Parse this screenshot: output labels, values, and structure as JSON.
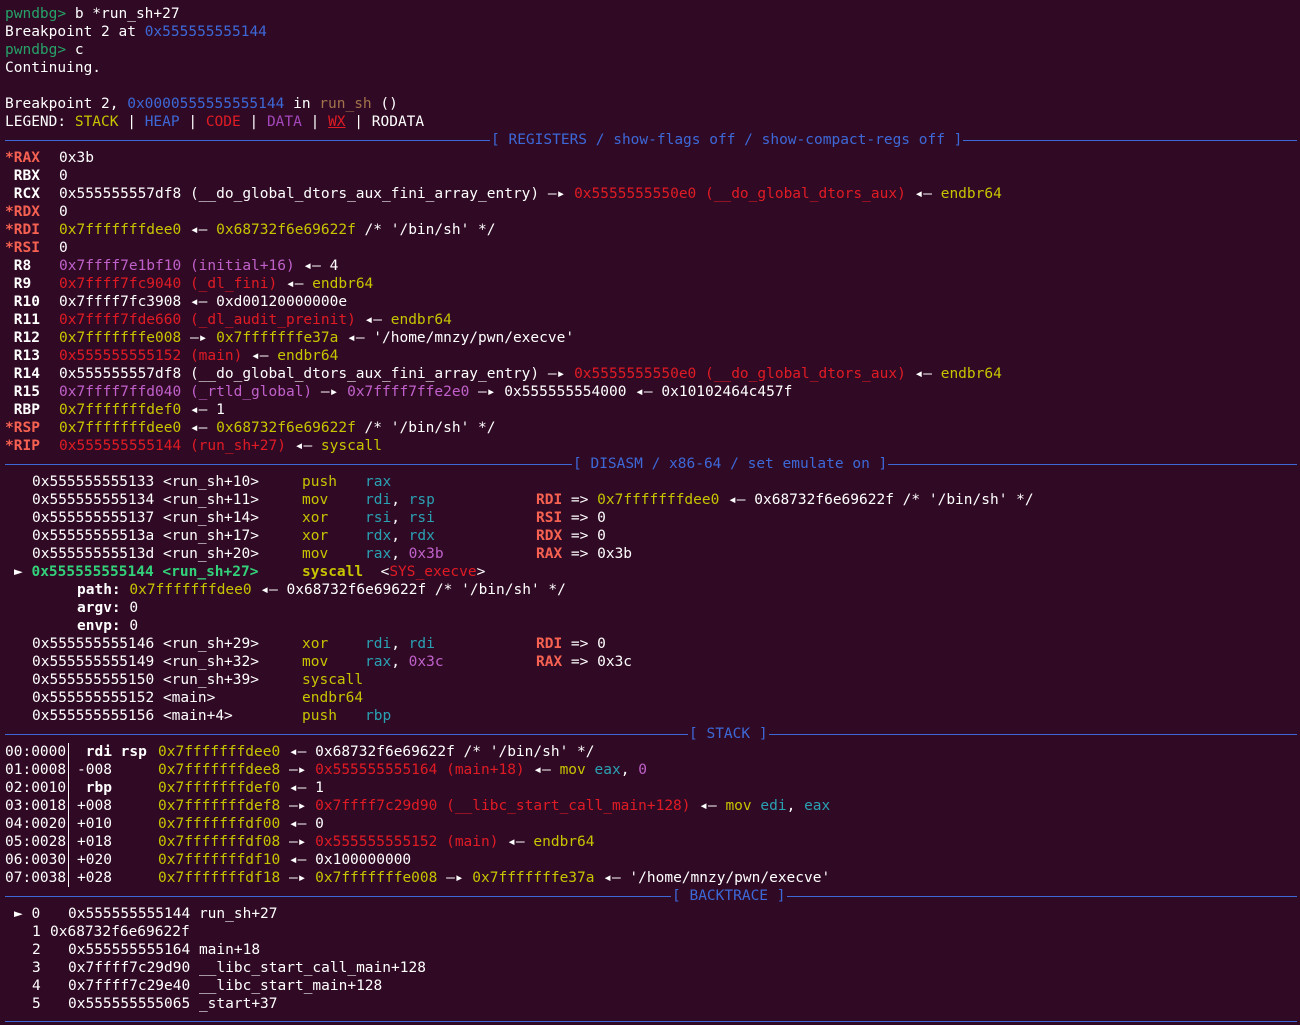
{
  "prompt": "pwndbg>",
  "cmd1": "b *run_sh+27",
  "bp_set_prefix": "Breakpoint 2 at ",
  "bp_set_addr": "0x555555555144",
  "cmd2": "c",
  "continuing": "Continuing.",
  "bp_hit": {
    "prefix": "Breakpoint 2, ",
    "addr": "0x0000555555555144",
    "in": " in ",
    "func": "run_sh",
    "suffix": " ()"
  },
  "legend": {
    "label": "LEGEND: ",
    "stack": "STACK",
    "heap": "HEAP",
    "code": "CODE",
    "data": "DATA",
    "wx": "WX",
    "rodata": "RODATA",
    "sep": " | "
  },
  "sections": {
    "registers": "[ REGISTERS / show-flags off / show-compact-regs off ]",
    "disasm": "[ DISASM / x86-64 / set emulate on ]",
    "stack": "[ STACK ]",
    "backtrace": "[ BACKTRACE ]"
  },
  "registers": [
    {
      "name": "*RAX",
      "value": "0x3b"
    },
    {
      "name": " RBX",
      "value": "0"
    },
    {
      "name": " RCX",
      "value": "0x555555557df8 (__do_global_dtors_aux_fini_array_entry) —▸ 0x5555555550e0 (__do_global_dtors_aux) ◂— endbr64"
    },
    {
      "name": "*RDX",
      "value": "0"
    },
    {
      "name": "*RDI",
      "value": "0x7fffffffdee0 ◂— 0x68732f6e69622f /* '/bin/sh' */"
    },
    {
      "name": "*RSI",
      "value": "0"
    },
    {
      "name": " R8",
      "value": "0x7ffff7e1bf10 (initial+16) ◂— 4"
    },
    {
      "name": " R9",
      "value": "0x7ffff7fc9040 (_dl_fini) ◂— endbr64"
    },
    {
      "name": " R10",
      "value": "0x7ffff7fc3908 ◂— 0xd00120000000e"
    },
    {
      "name": " R11",
      "value": "0x7ffff7fde660 (_dl_audit_preinit) ◂— endbr64"
    },
    {
      "name": " R12",
      "value": "0x7fffffffe008 —▸ 0x7fffffffe37a ◂— '/home/mnzy/pwn/execve'"
    },
    {
      "name": " R13",
      "value": "0x555555555152 (main) ◂— endbr64"
    },
    {
      "name": " R14",
      "value": "0x555555557df8 (__do_global_dtors_aux_fini_array_entry) —▸ 0x5555555550e0 (__do_global_dtors_aux) ◂— endbr64"
    },
    {
      "name": " R15",
      "value": "0x7ffff7ffd040 (_rtld_global) —▸ 0x7ffff7ffe2e0 —▸ 0x555555554000 ◂— 0x10102464c457f"
    },
    {
      "name": " RBP",
      "value": "0x7fffffffdef0 ◂— 1"
    },
    {
      "name": "*RSP",
      "value": "0x7fffffffdee0 ◂— 0x68732f6e69622f /* '/bin/sh' */"
    },
    {
      "name": "*RIP",
      "value": "0x555555555144 (run_sh+27) ◂— syscall"
    }
  ],
  "disasm": [
    {
      "addr": "0x555555555133 <run_sh+10>",
      "mnem": "push",
      "ops": "rax",
      "note": ""
    },
    {
      "addr": "0x555555555134 <run_sh+11>",
      "mnem": "mov",
      "ops": "rdi, rsp",
      "note": "RDI => 0x7fffffffdee0 ◂— 0x68732f6e69622f /* '/bin/sh' */"
    },
    {
      "addr": "0x555555555137 <run_sh+14>",
      "mnem": "xor",
      "ops": "rsi, rsi",
      "note": "RSI => 0"
    },
    {
      "addr": "0x55555555513a <run_sh+17>",
      "mnem": "xor",
      "ops": "rdx, rdx",
      "note": "RDX => 0"
    },
    {
      "addr": "0x55555555513d <run_sh+20>",
      "mnem": "mov",
      "ops": "rax, 0x3b",
      "note": "RAX => 0x3b"
    },
    {
      "addr": "► 0x555555555144 <run_sh+27>",
      "mnem": "syscall",
      "ops": "<SYS_execve>",
      "note": ""
    },
    {
      "addr": "path: 0x7fffffffdee0 ◂— 0x68732f6e69622f /* '/bin/sh' */",
      "mnem": "",
      "ops": "",
      "note": ""
    },
    {
      "addr": "argv: 0",
      "mnem": "",
      "ops": "",
      "note": ""
    },
    {
      "addr": "envp: 0",
      "mnem": "",
      "ops": "",
      "note": ""
    },
    {
      "addr": "0x555555555146 <run_sh+29>",
      "mnem": "xor",
      "ops": "rdi, rdi",
      "note": "RDI => 0"
    },
    {
      "addr": "0x555555555149 <run_sh+32>",
      "mnem": "mov",
      "ops": "rax, 0x3c",
      "note": "RAX => 0x3c"
    },
    {
      "addr": "0x555555555150 <run_sh+39>",
      "mnem": "syscall",
      "ops": "",
      "note": ""
    },
    {
      "addr": "0x555555555152 <main>",
      "mnem": "endbr64",
      "ops": "",
      "note": ""
    },
    {
      "addr": "0x555555555156 <main+4>",
      "mnem": "push",
      "ops": "rbp",
      "note": ""
    }
  ],
  "stack": [
    {
      "idx": "00:0000",
      "off": " rdi rsp",
      "val": "0x7fffffffdee0 ◂— 0x68732f6e69622f /* '/bin/sh' */"
    },
    {
      "idx": "01:0008",
      "off": "-008",
      "val": "0x7fffffffdee8 —▸ 0x555555555164 (main+18) ◂— mov eax, 0"
    },
    {
      "idx": "02:0010",
      "off": " rbp",
      "val": "0x7fffffffdef0 ◂— 1"
    },
    {
      "idx": "03:0018",
      "off": "+008",
      "val": "0x7fffffffdef8 —▸ 0x7ffff7c29d90 (__libc_start_call_main+128) ◂— mov edi, eax"
    },
    {
      "idx": "04:0020",
      "off": "+010",
      "val": "0x7fffffffdf00 ◂— 0"
    },
    {
      "idx": "05:0028",
      "off": "+018",
      "val": "0x7fffffffdf08 —▸ 0x555555555152 (main) ◂— endbr64"
    },
    {
      "idx": "06:0030",
      "off": "+020",
      "val": "0x7fffffffdf10 ◂— 0x100000000"
    },
    {
      "idx": "07:0038",
      "off": "+028",
      "val": "0x7fffffffdf18 —▸ 0x7fffffffe008 —▸ 0x7fffffffe37a ◂— '/home/mnzy/pwn/execve'"
    }
  ],
  "backtrace": [
    {
      "num": "► 0",
      "text": "0x555555555144 run_sh+27"
    },
    {
      "num": "1",
      "text": "0x68732f6e69622f"
    },
    {
      "num": "2",
      "text": "0x555555555164 main+18"
    },
    {
      "num": "3",
      "text": "0x7ffff7c29d90 __libc_start_call_main+128"
    },
    {
      "num": "4",
      "text": "0x7ffff7c29e40 __libc_start_main+128"
    },
    {
      "num": "5",
      "text": "0x555555555065 _start+37"
    }
  ]
}
